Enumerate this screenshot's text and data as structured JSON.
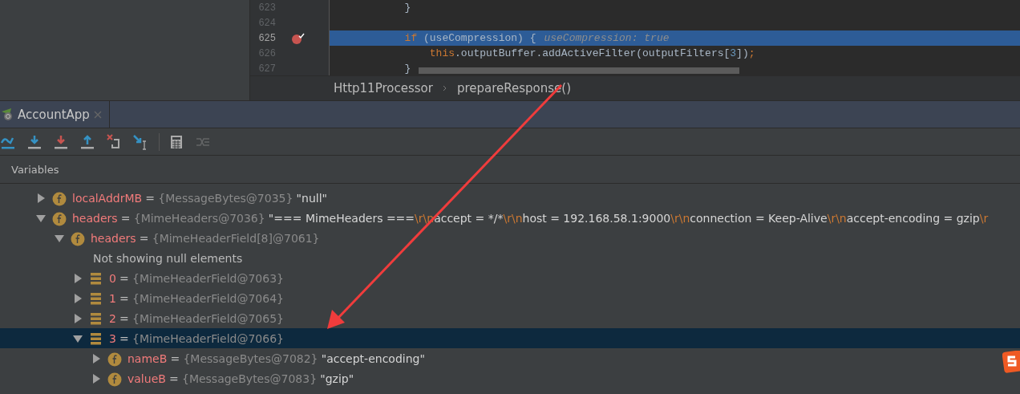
{
  "editor": {
    "lines": [
      {
        "number": "623",
        "breakpoint": false,
        "highlighted": false,
        "tokens": [
          {
            "text": "            }",
            "kind": "plain"
          }
        ]
      },
      {
        "number": "624",
        "breakpoint": false,
        "highlighted": false
      },
      {
        "number": "625",
        "breakpoint": true,
        "highlighted": true,
        "tokens": [
          {
            "text": "            if",
            "kind": "keyword"
          },
          {
            "text": " (useCompression) {",
            "kind": "plain"
          }
        ],
        "hint": "useCompression: true"
      },
      {
        "number": "626",
        "breakpoint": false,
        "highlighted": false,
        "tokens": [
          {
            "text": "                this",
            "kind": "keyword"
          },
          {
            "text": ".outputBuffer.addActiveFilter(outputFilters[",
            "kind": "plain"
          },
          {
            "text": "3",
            "kind": "number"
          },
          {
            "text": "])",
            "kind": "plain"
          },
          {
            "text": ";",
            "kind": "keyword"
          }
        ]
      },
      {
        "number": "627",
        "breakpoint": false,
        "highlighted": false,
        "tokens": [
          {
            "text": "            }",
            "kind": "plain"
          }
        ]
      }
    ],
    "breadcrumb": [
      "Http11Processor",
      "prepareResponse()"
    ]
  },
  "debug_tab": {
    "label": "AccountApp",
    "selected": true
  },
  "toolbar": [
    {
      "kind": "step-over",
      "disabled": false
    },
    {
      "kind": "step-into",
      "disabled": false
    },
    {
      "kind": "force-step-into",
      "disabled": false
    },
    {
      "kind": "step-out",
      "disabled": false
    },
    {
      "kind": "drop-frame",
      "disabled": false
    },
    {
      "kind": "run-to-cursor",
      "disabled": false
    },
    {
      "kind": "separator"
    },
    {
      "kind": "evaluate",
      "disabled": false
    },
    {
      "kind": "trace",
      "disabled": true
    }
  ],
  "variables": {
    "title": "Variables",
    "tree": [
      {
        "kind": "field",
        "parts": [
          {
            "text": "localAddrMB",
            "kind": "name"
          },
          {
            "text": "=",
            "kind": "op"
          },
          {
            "text": "{MessageBytes@7035}",
            "kind": "type"
          },
          {
            "text": "\"null\"",
            "kind": "string"
          }
        ],
        "expanded": false,
        "selected": false
      },
      {
        "kind": "field",
        "parts": [
          {
            "text": "headers",
            "kind": "name"
          },
          {
            "text": "=",
            "kind": "op"
          },
          {
            "text": "{MimeHeaders@7036}",
            "kind": "type"
          },
          {
            "text": "\"=== MimeHeaders ===",
            "kind": "string"
          },
          {
            "text": "\\r\\n",
            "kind": "escape"
          },
          {
            "text": "accept = */*",
            "kind": "string"
          },
          {
            "text": "\\r\\n",
            "kind": "escape"
          },
          {
            "text": "host = 192.168.58.1:9000",
            "kind": "string"
          },
          {
            "text": "\\r\\n",
            "kind": "escape"
          },
          {
            "text": "connection = Keep-Alive",
            "kind": "string"
          },
          {
            "text": "\\r\\n",
            "kind": "escape"
          },
          {
            "text": "accept-encoding = gzip",
            "kind": "string"
          },
          {
            "text": "\\r",
            "kind": "escape"
          }
        ],
        "expanded": true,
        "selected": false,
        "children": [
          {
            "kind": "field",
            "parts": [
              {
                "text": "headers",
                "kind": "name"
              },
              {
                "text": "=",
                "kind": "op"
              },
              {
                "text": "{MimeHeaderField[8]@7061}",
                "kind": "type"
              }
            ],
            "expanded": true,
            "selected": false,
            "children": [
              {
                "kind": "note",
                "text": "Not showing null elements"
              },
              {
                "kind": "element",
                "parts": [
                  {
                    "text": "0",
                    "kind": "name"
                  },
                  {
                    "text": "=",
                    "kind": "op"
                  },
                  {
                    "text": "{MimeHeaderField@7063}",
                    "kind": "type"
                  }
                ],
                "expanded": false,
                "selected": false
              },
              {
                "kind": "element",
                "parts": [
                  {
                    "text": "1",
                    "kind": "name"
                  },
                  {
                    "text": "=",
                    "kind": "op"
                  },
                  {
                    "text": "{MimeHeaderField@7064}",
                    "kind": "type"
                  }
                ],
                "expanded": false,
                "selected": false
              },
              {
                "kind": "element",
                "parts": [
                  {
                    "text": "2",
                    "kind": "name"
                  },
                  {
                    "text": "=",
                    "kind": "op"
                  },
                  {
                    "text": "{MimeHeaderField@7065}",
                    "kind": "type"
                  }
                ],
                "expanded": false,
                "selected": false
              },
              {
                "kind": "element",
                "parts": [
                  {
                    "text": "3",
                    "kind": "name"
                  },
                  {
                    "text": "=",
                    "kind": "op"
                  },
                  {
                    "text": "{MimeHeaderField@7066}",
                    "kind": "type"
                  }
                ],
                "expanded": true,
                "selected": true,
                "children": [
                  {
                    "kind": "field",
                    "parts": [
                      {
                        "text": "nameB",
                        "kind": "name"
                      },
                      {
                        "text": "=",
                        "kind": "op"
                      },
                      {
                        "text": "{MessageBytes@7082}",
                        "kind": "type"
                      },
                      {
                        "text": "\"accept-encoding\"",
                        "kind": "string"
                      }
                    ],
                    "expanded": false,
                    "selected": false
                  },
                  {
                    "kind": "field",
                    "parts": [
                      {
                        "text": "valueB",
                        "kind": "name"
                      },
                      {
                        "text": "=",
                        "kind": "op"
                      },
                      {
                        "text": "{MessageBytes@7083}",
                        "kind": "type"
                      },
                      {
                        "text": "\"gzip\"",
                        "kind": "string"
                      }
                    ],
                    "expanded": false,
                    "selected": false
                  }
                ]
              }
            ]
          }
        ]
      }
    ]
  }
}
